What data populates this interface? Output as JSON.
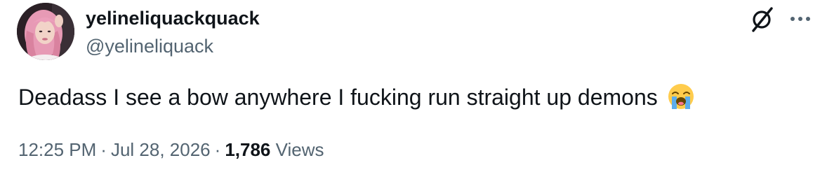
{
  "author": {
    "display_name": "yelineliquackquack",
    "handle": "@yelineliquack",
    "avatar_icon": "profile-photo"
  },
  "tweet": {
    "text": "Deadass I see a bow anywhere I fucking run straight up demons",
    "emoji_icon": "loudly-crying-face"
  },
  "meta": {
    "time": "12:25 PM",
    "separator": "·",
    "date": "Jul 28, 2026",
    "views_count": "1,786",
    "views_label": "Views"
  },
  "actions": {
    "grok_icon": "grok-slash-icon",
    "more_icon": "ellipsis-icon"
  },
  "colors": {
    "text_primary": "#0f1419",
    "text_secondary": "#536471",
    "background": "#ffffff"
  }
}
